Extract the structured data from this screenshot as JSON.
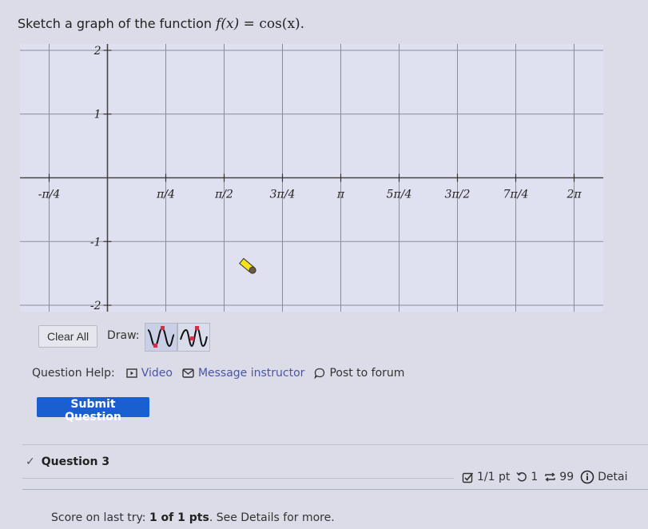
{
  "prompt": {
    "text": "Sketch a graph of the function",
    "math_lhs": "f(x)",
    "math_eq": " = ",
    "math_rhs": "cos(x)",
    "period": "."
  },
  "graph": {
    "x_ticks": [
      {
        "label": "-π/4",
        "value": -0.25
      },
      {
        "label": "π/4",
        "value": 0.25
      },
      {
        "label": "π/2",
        "value": 0.5
      },
      {
        "label": "3π/4",
        "value": 0.75
      },
      {
        "label": "π",
        "value": 1.0
      },
      {
        "label": "5π/4",
        "value": 1.25
      },
      {
        "label": "3π/2",
        "value": 1.5
      },
      {
        "label": "7π/4",
        "value": 1.75
      },
      {
        "label": "2π",
        "value": 2.0
      }
    ],
    "x_unit": "π",
    "x_range": [
      -0.375,
      2.125
    ],
    "y_ticks": [
      {
        "label": "2",
        "value": 2
      },
      {
        "label": "1",
        "value": 1
      },
      {
        "label": "-1",
        "value": -1
      },
      {
        "label": "-2",
        "value": -2
      }
    ],
    "y_range": [
      -2.1,
      2.1
    ],
    "curve_drawn": false,
    "cursor": "pencil-cursor"
  },
  "controls": {
    "clear_all": "Clear All",
    "draw_label": "Draw:",
    "tools": [
      {
        "name": "sine-tool",
        "selected": true
      },
      {
        "name": "sine-shifted-tool",
        "selected": false
      }
    ]
  },
  "help": {
    "label": "Question Help:",
    "video": "Video",
    "message": "Message instructor",
    "forum": "Post to forum"
  },
  "submit": "Submit Question",
  "next_question": {
    "title": "Question 3",
    "status_icon": "check",
    "points": "1/1 pt",
    "retries": "1",
    "attempts": "99",
    "details": "Detai",
    "score_prefix": "Score on last try: ",
    "score_bold": "1 of 1 pts",
    "score_suffix": ". See Details for more."
  },
  "colors": {
    "accent": "#1a5fd0",
    "link": "#4a54a8",
    "tool_marker": "#d0304a"
  }
}
